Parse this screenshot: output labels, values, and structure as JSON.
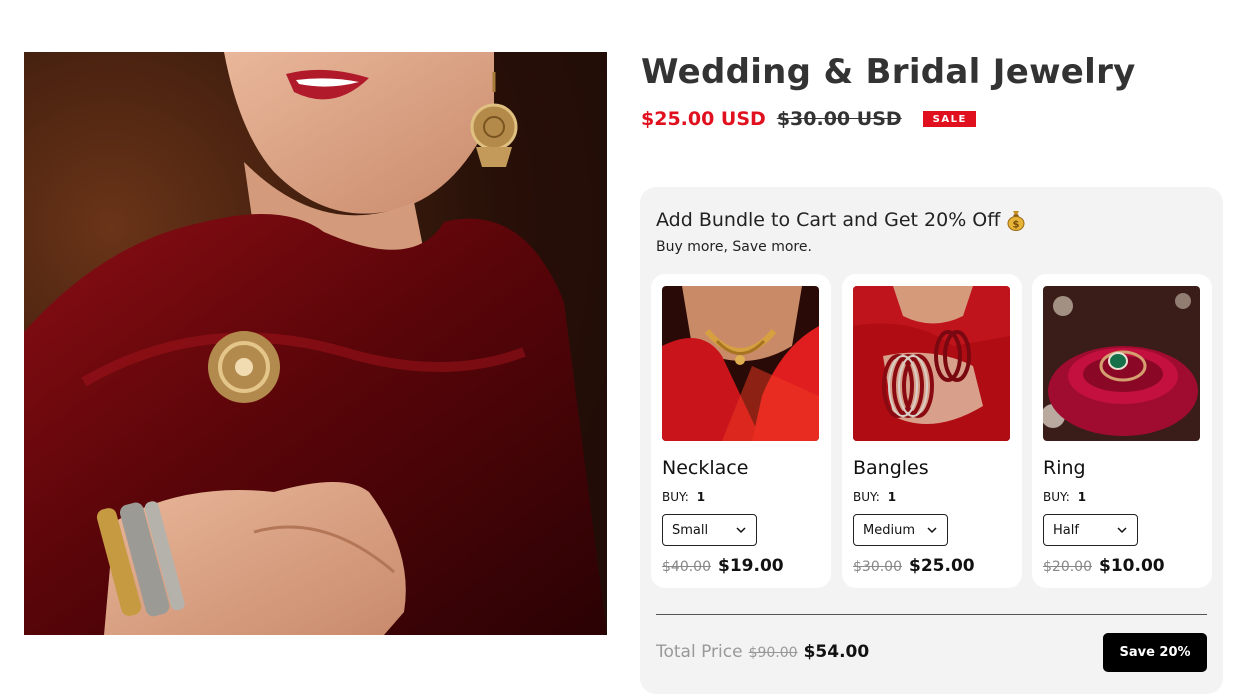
{
  "product": {
    "title": "Wedding & Bridal Jewelry",
    "sale_price": "$25.00 USD",
    "compare_price": "$30.00 USD",
    "badge": "SALE"
  },
  "bundle": {
    "title": "Add Bundle to Cart and Get 20% Off",
    "title_icon": "money-bag-icon",
    "subtitle": "Buy more, Save more.",
    "buy_label": "BUY:",
    "items": [
      {
        "name": "Necklace",
        "quantity": "1",
        "variant": "Small",
        "old_price": "$40.00",
        "new_price": "$19.00"
      },
      {
        "name": "Bangles",
        "quantity": "1",
        "variant": "Medium",
        "old_price": "$30.00",
        "new_price": "$25.00"
      },
      {
        "name": "Ring",
        "quantity": "1",
        "variant": "Half",
        "old_price": "$20.00",
        "new_price": "$10.00"
      }
    ],
    "total_label": "Total Price",
    "total_old": "$90.00",
    "total_new": "$54.00",
    "save_button": "Save 20%"
  },
  "colors": {
    "sale_red": "#e0101e",
    "panel_bg": "#f3f3f3",
    "button_bg": "#000000"
  }
}
